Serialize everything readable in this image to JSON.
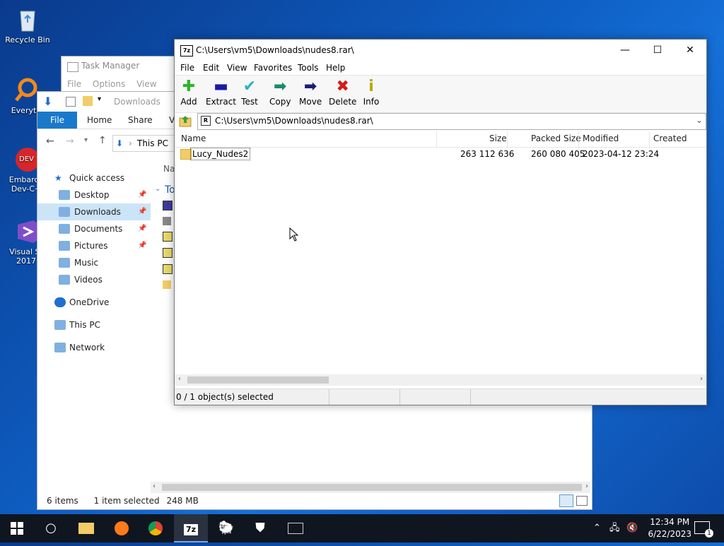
{
  "desktop": {
    "icons": [
      {
        "label": "Recycle Bin"
      },
      {
        "label": "Everyth"
      },
      {
        "label": "Embarca Dev-C+"
      },
      {
        "label": "Visual St 2017"
      }
    ]
  },
  "task_manager": {
    "title": "Task Manager",
    "menu": [
      "File",
      "Options",
      "View"
    ]
  },
  "explorer": {
    "qat_title": "Downloads",
    "ribbon": {
      "file": "File",
      "tabs": [
        "Home",
        "Share",
        "V"
      ]
    },
    "path": "This PC",
    "column_header_partial": "Nar",
    "group_header_partial": "To",
    "sidebar": [
      {
        "label": "Quick access",
        "icon": "star-icon",
        "level": 0
      },
      {
        "label": "Desktop",
        "icon": "desktop-icon",
        "level": 1,
        "pinned": true
      },
      {
        "label": "Downloads",
        "icon": "download-icon",
        "level": 1,
        "pinned": true,
        "selected": true
      },
      {
        "label": "Documents",
        "icon": "document-icon",
        "level": 1,
        "pinned": true
      },
      {
        "label": "Pictures",
        "icon": "pictures-icon",
        "level": 1,
        "pinned": true
      },
      {
        "label": "Music",
        "icon": "music-icon",
        "level": 1
      },
      {
        "label": "Videos",
        "icon": "video-icon",
        "level": 1
      },
      {
        "label": "OneDrive",
        "icon": "cloud-icon",
        "level": 0
      },
      {
        "label": "This PC",
        "icon": "computer-icon",
        "level": 0
      },
      {
        "label": "Network",
        "icon": "network-icon",
        "level": 0
      }
    ],
    "status": {
      "items": "6 items",
      "selected": "1 item selected",
      "size": "248 MB"
    }
  },
  "sevenzip": {
    "title": "C:\\Users\\vm5\\Downloads\\nudes8.rar\\",
    "app_icon_text": "7z",
    "menu": [
      "File",
      "Edit",
      "View",
      "Favorites",
      "Tools",
      "Help"
    ],
    "toolbar": [
      {
        "label": "Add",
        "icon": "plus-icon",
        "color": "#2db52d",
        "glyph": "✚"
      },
      {
        "label": "Extract",
        "icon": "minus-icon",
        "color": "#1a1aa8",
        "glyph": "▬"
      },
      {
        "label": "Test",
        "icon": "check-icon",
        "color": "#2bb0c8",
        "glyph": "✔"
      },
      {
        "label": "Copy",
        "icon": "copy-arrow-icon",
        "color": "#1c8a6e",
        "glyph": "➡"
      },
      {
        "label": "Move",
        "icon": "move-arrow-icon",
        "color": "#1d1d7a",
        "glyph": "➡"
      },
      {
        "label": "Delete",
        "icon": "delete-x-icon",
        "color": "#d61a1a",
        "glyph": "✖"
      },
      {
        "label": "Info",
        "icon": "info-icon",
        "color": "#b8a800",
        "glyph": "i"
      }
    ],
    "address": "C:\\Users\\vm5\\Downloads\\nudes8.rar\\",
    "columns": [
      "Name",
      "Size",
      "Packed Size",
      "Modified",
      "Created"
    ],
    "rows": [
      {
        "name": "Lucy_Nudes2",
        "size": "263 112 636",
        "packed": "260 080 405",
        "modified": "2023-04-12 23:24",
        "created": ""
      }
    ],
    "status": "0 / 1 object(s) selected"
  },
  "taskbar": {
    "time": "12:34 PM",
    "date": "6/22/2023",
    "notification_count": "1"
  }
}
